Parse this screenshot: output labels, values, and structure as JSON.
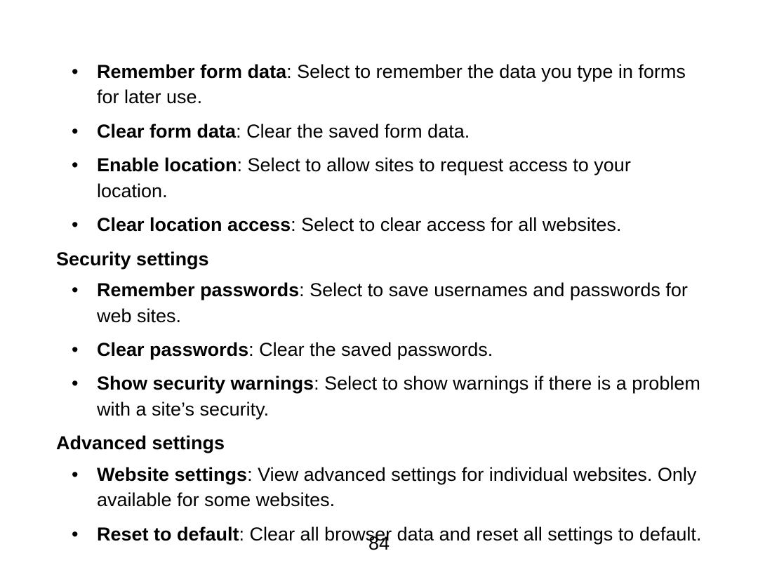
{
  "section1": {
    "items": [
      {
        "title": "Remember form data",
        "desc": ": Select to remember the data you type in forms for later use."
      },
      {
        "title": "Clear form data",
        "desc": ": Clear the saved form data."
      },
      {
        "title": "Enable location",
        "desc": ": Select to allow sites to request access to your location."
      },
      {
        "title": "Clear location access",
        "desc": ": Select to clear access for all websites."
      }
    ]
  },
  "section2": {
    "heading": "Security settings",
    "items": [
      {
        "title": "Remember passwords",
        "desc": ": Select to save usernames and passwords for web sites."
      },
      {
        "title": "Clear passwords",
        "desc": ": Clear the saved passwords."
      },
      {
        "title": "Show security warnings",
        "desc": ": Select to show warnings if there is a problem with a site’s security."
      }
    ]
  },
  "section3": {
    "heading": "Advanced settings",
    "items": [
      {
        "title": "Website settings",
        "desc": ": View advanced settings for individual websites. Only available for some websites."
      },
      {
        "title": "Reset to default",
        "desc": ": Clear all browser data and reset all settings to default."
      }
    ]
  },
  "pageNumber": "84"
}
